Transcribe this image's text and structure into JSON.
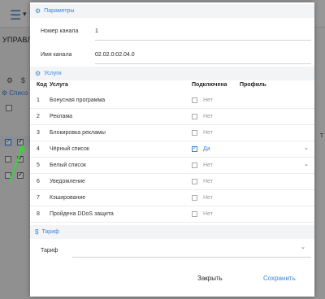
{
  "background": {
    "heading": "УПРАВЛЕН",
    "list_label": "Списо",
    "right_text": "Т"
  },
  "modal": {
    "params_header": "Параметры",
    "channel_number_label": "Номер канала",
    "channel_number_value": "1",
    "channel_name_label": "Имя канала",
    "channel_name_value": "02.02.0:02.04.0",
    "services_header": "Услуги",
    "columns": {
      "code": "Код",
      "service": "Услуга",
      "connected": "Подключена",
      "profile": "Профиль"
    },
    "services": [
      {
        "code": "1",
        "name": "Бонусная программа",
        "connected": false,
        "state": "Нет",
        "has_profile": false
      },
      {
        "code": "2",
        "name": "Реклама",
        "connected": false,
        "state": "Нет",
        "has_profile": false
      },
      {
        "code": "3",
        "name": "Блокировка рекламы",
        "connected": false,
        "state": "Нет",
        "has_profile": false
      },
      {
        "code": "4",
        "name": "Чёрный список",
        "connected": true,
        "state": "Да",
        "has_profile": true
      },
      {
        "code": "5",
        "name": "Белый список",
        "connected": false,
        "state": "Нет",
        "has_profile": true
      },
      {
        "code": "6",
        "name": "Уведомление",
        "connected": false,
        "state": "Нет",
        "has_profile": false
      },
      {
        "code": "7",
        "name": "Кэширование",
        "connected": false,
        "state": "Нет",
        "has_profile": false
      },
      {
        "code": "8",
        "name": "Пройдена DDoS защита",
        "connected": false,
        "state": "Нет",
        "has_profile": false
      }
    ],
    "tarif_header": "Тариф",
    "tarif_label": "Тариф",
    "close_label": "Закрыть",
    "save_label": "Сохранить"
  },
  "colors": {
    "accent": "#3a86d6",
    "overlay": "#000000"
  }
}
